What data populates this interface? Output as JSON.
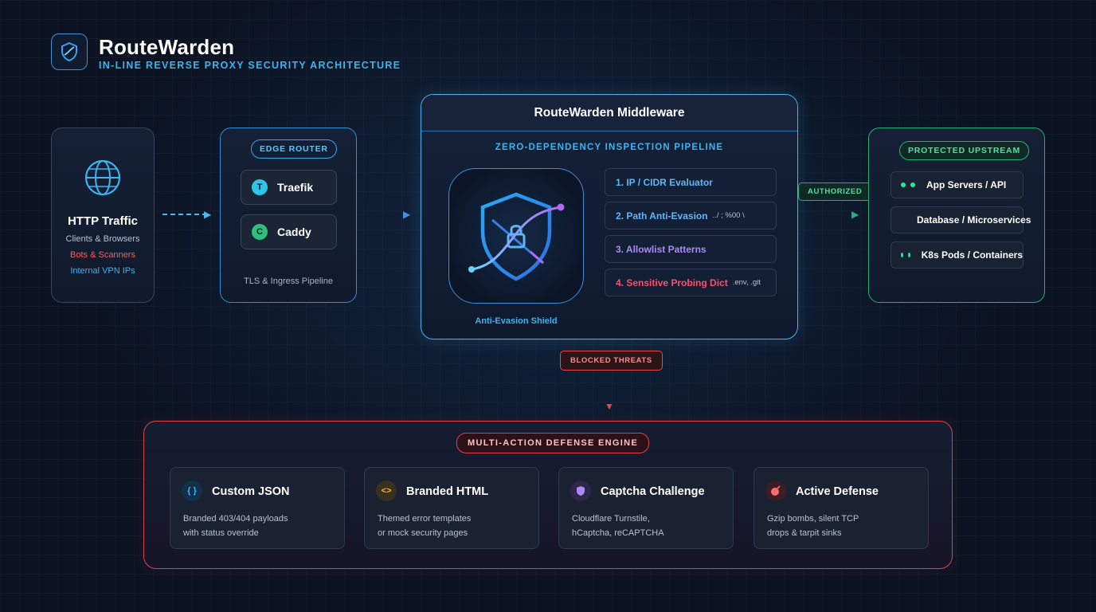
{
  "header": {
    "title": "RouteWarden",
    "subtitle": "IN-LINE REVERSE PROXY SECURITY ARCHITECTURE"
  },
  "traffic": {
    "title": "HTTP Traffic",
    "lines": [
      {
        "text": "Clients & Browsers",
        "color": "#b7c2d2"
      },
      {
        "text": "Bots & Scanners",
        "color": "#ff5a5a"
      },
      {
        "text": "Internal VPN IPs",
        "color": "#38b6f0"
      }
    ]
  },
  "edge_router": {
    "label": "EDGE ROUTER",
    "items": [
      {
        "badge": "T",
        "name": "Traefik",
        "color": "#2ec5e8"
      },
      {
        "badge": "C",
        "name": "Caddy",
        "color": "#2ec07a"
      }
    ],
    "footer": "TLS & Ingress Pipeline"
  },
  "middleware": {
    "title": "RouteWarden Middleware",
    "subtitle": "ZERO-DEPENDENCY INSPECTION PIPELINE",
    "shield_label": "Anti-Evasion Shield",
    "steps": [
      {
        "label": "1. IP / CIDR Evaluator",
        "hint": "",
        "color": "#5fb6f5"
      },
      {
        "label": "2. Path Anti-Evasion",
        "hint": "../ ; %00 \\",
        "color": "#5fb6f5"
      },
      {
        "label": "3. Allowlist Patterns",
        "hint": "",
        "color": "#a98bf5"
      },
      {
        "label": "4. Sensitive Probing Dict",
        "hint": ".env, .git",
        "color": "#ff4d6a"
      }
    ]
  },
  "connectors": {
    "authorized": "AUTHORIZED",
    "blocked": "BLOCKED THREATS"
  },
  "upstream": {
    "label": "PROTECTED UPSTREAM",
    "items": [
      "App Servers / API",
      "Database / Microservices",
      "K8s Pods / Containers"
    ]
  },
  "defense": {
    "label": "MULTI-ACTION DEFENSE ENGINE",
    "cards": [
      {
        "title": "Custom JSON",
        "icon": "{ }",
        "icon_name": "braces-icon",
        "line1": "Branded 403/404 payloads",
        "line2": "with status override",
        "icon_color": "#38b6f0",
        "icon_bg": "#13304a"
      },
      {
        "title": "Branded HTML",
        "icon": "<>",
        "icon_name": "code-icon",
        "line1": "Themed error templates",
        "line2": "or mock security pages",
        "icon_color": "#f5b731",
        "icon_bg": "#3a3020"
      },
      {
        "title": "Captcha Challenge",
        "icon": "",
        "icon_name": "shield-badge-icon",
        "line1": "Cloudflare Turnstile,",
        "line2": "hCaptcha, reCAPTCHA",
        "icon_color": "#a98bf5",
        "icon_bg": "#2c2648"
      },
      {
        "title": "Active Defense",
        "icon": "",
        "icon_name": "bomb-icon",
        "line1": "Gzip bombs, silent TCP",
        "line2": "drops & tarpit sinks",
        "icon_color": "#ff6b6b",
        "icon_bg": "#3a1e24"
      }
    ]
  }
}
